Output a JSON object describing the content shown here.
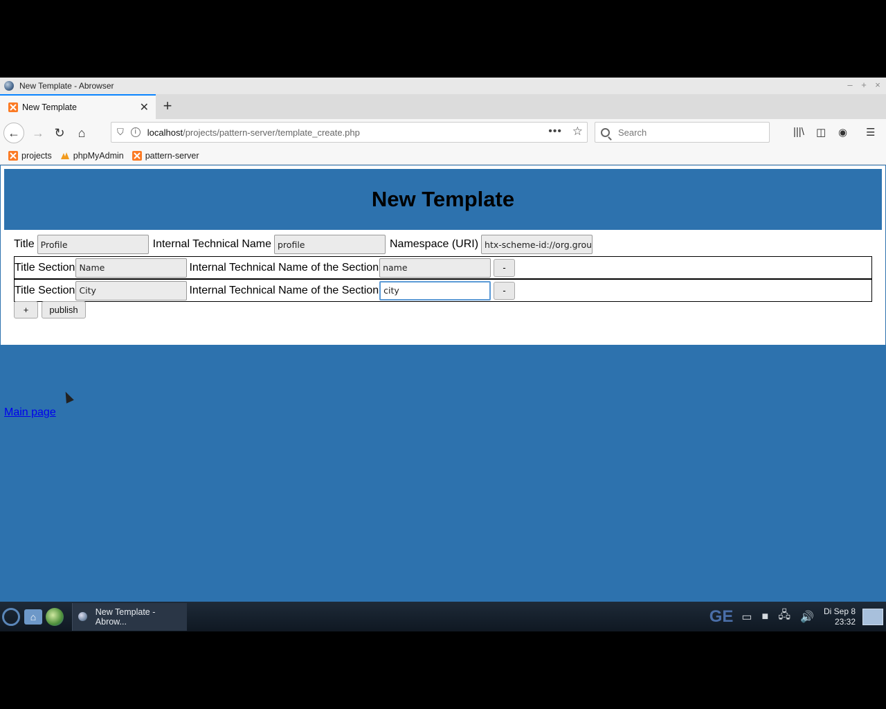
{
  "window": {
    "title": "New Template - Abrowser"
  },
  "tab": {
    "label": "New Template"
  },
  "navbar": {
    "url_host": "localhost",
    "url_path": "/projects/pattern-server/template_create.php",
    "search_placeholder": "Search"
  },
  "bookmarks": [
    {
      "label": "projects"
    },
    {
      "label": "phpMyAdmin"
    },
    {
      "label": "pattern-server"
    }
  ],
  "page": {
    "heading": "New Template",
    "title_label": "Title",
    "title_value": "Profile",
    "tech_label": "Internal Technical Name",
    "tech_value": "profile",
    "ns_label": "Namespace (URI)",
    "ns_value": "htx-scheme-id://org.groupwa",
    "sections": [
      {
        "title_label": "Title Section",
        "title_value": "Name",
        "tech_label": "Internal Technical Name of the Section",
        "tech_value": "name",
        "remove_label": "-"
      },
      {
        "title_label": "Title Section",
        "title_value": "City",
        "tech_label": "Internal Technical Name of the Section",
        "tech_value": "city",
        "remove_label": "-"
      }
    ],
    "add_label": "+",
    "publish_label": "publish",
    "main_link": "Main page"
  },
  "taskbar": {
    "task_label": "New Template - Abrow...",
    "tray_ge": "GE",
    "clock_day": "Di Sep  8",
    "clock_time": "23:32"
  },
  "colors": {
    "page_bg": "#2d72ae",
    "tab_accent": "#0a84ff",
    "link": "#0000ee"
  }
}
